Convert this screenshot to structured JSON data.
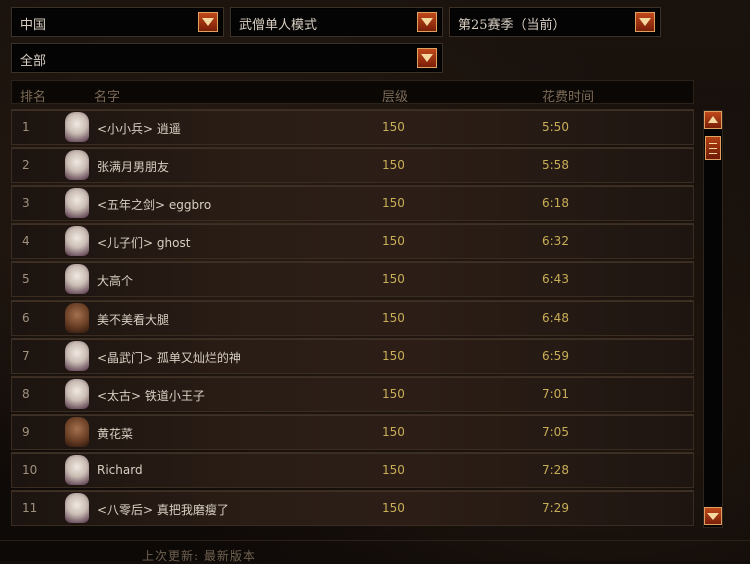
{
  "filters": {
    "region": "中国",
    "mode": "武僧单人模式",
    "season": "第25赛季（当前）",
    "category": "全部"
  },
  "table": {
    "headers": {
      "rank": "排名",
      "name": "名字",
      "level": "层级",
      "time": "花费时间"
    },
    "rows": [
      {
        "rank": "1",
        "name": "<小小兵> 逍遥",
        "level": "150",
        "time": "5:50",
        "avatar": "light"
      },
      {
        "rank": "2",
        "name": "张满月男朋友",
        "level": "150",
        "time": "5:58",
        "avatar": "light"
      },
      {
        "rank": "3",
        "name": "<五年之剑> eggbro",
        "level": "150",
        "time": "6:18",
        "avatar": "light"
      },
      {
        "rank": "4",
        "name": "<儿子们> ghost",
        "level": "150",
        "time": "6:32",
        "avatar": "light"
      },
      {
        "rank": "5",
        "name": "大高个",
        "level": "150",
        "time": "6:43",
        "avatar": "light"
      },
      {
        "rank": "6",
        "name": "美不美看大腿",
        "level": "150",
        "time": "6:48",
        "avatar": "dark"
      },
      {
        "rank": "7",
        "name": "<晶武门> 孤单又灿烂的神",
        "level": "150",
        "time": "6:59",
        "avatar": "light"
      },
      {
        "rank": "8",
        "name": "<太古> 铁道小王子",
        "level": "150",
        "time": "7:01",
        "avatar": "light"
      },
      {
        "rank": "9",
        "name": "黄花菜",
        "level": "150",
        "time": "7:05",
        "avatar": "dark"
      },
      {
        "rank": "10",
        "name": "Richard",
        "level": "150",
        "time": "7:28",
        "avatar": "light"
      },
      {
        "rank": "11",
        "name": "<八零后> 真把我磨瘦了",
        "level": "150",
        "time": "7:29",
        "avatar": "light"
      }
    ]
  },
  "footer": {
    "last_update": "上次更新: 最新版本"
  }
}
